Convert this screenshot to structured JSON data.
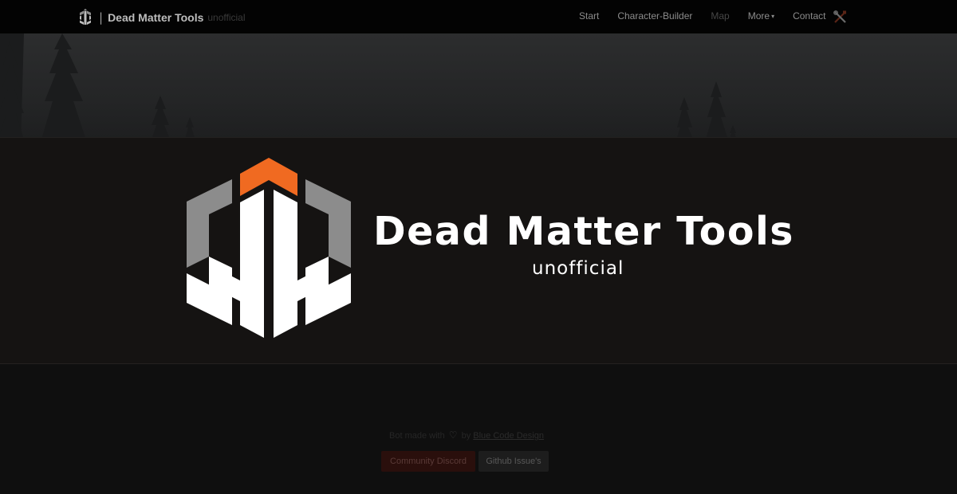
{
  "navbar": {
    "brand_logo_icon": "dmt-logo-icon",
    "brand_separator": "|",
    "brand_title": "Dead Matter Tools",
    "brand_subtitle": "unofficial",
    "links": {
      "start": "Start",
      "character_builder": "Character-Builder",
      "map": "Map",
      "more": "More",
      "more_caret": "▾",
      "contact": "Contact"
    },
    "tools_icon": "tools-icon"
  },
  "splash": {
    "logo_icon": "dmt-logo-icon",
    "title": "Dead Matter Tools",
    "subtitle": "unofficial"
  },
  "footer": {
    "made_with_prefix": "Bot made with",
    "heart_icon": "♡",
    "made_with_by": "by",
    "author": "Blue Code Design",
    "discord_button": "Community Discord",
    "github_button": "Github Issue's"
  },
  "colors": {
    "accent_orange": "#f06a21",
    "logo_gray": "#8c8c8c",
    "logo_white": "#ffffff",
    "overlay_bg": "#151312",
    "navbar_bg": "#030303"
  }
}
